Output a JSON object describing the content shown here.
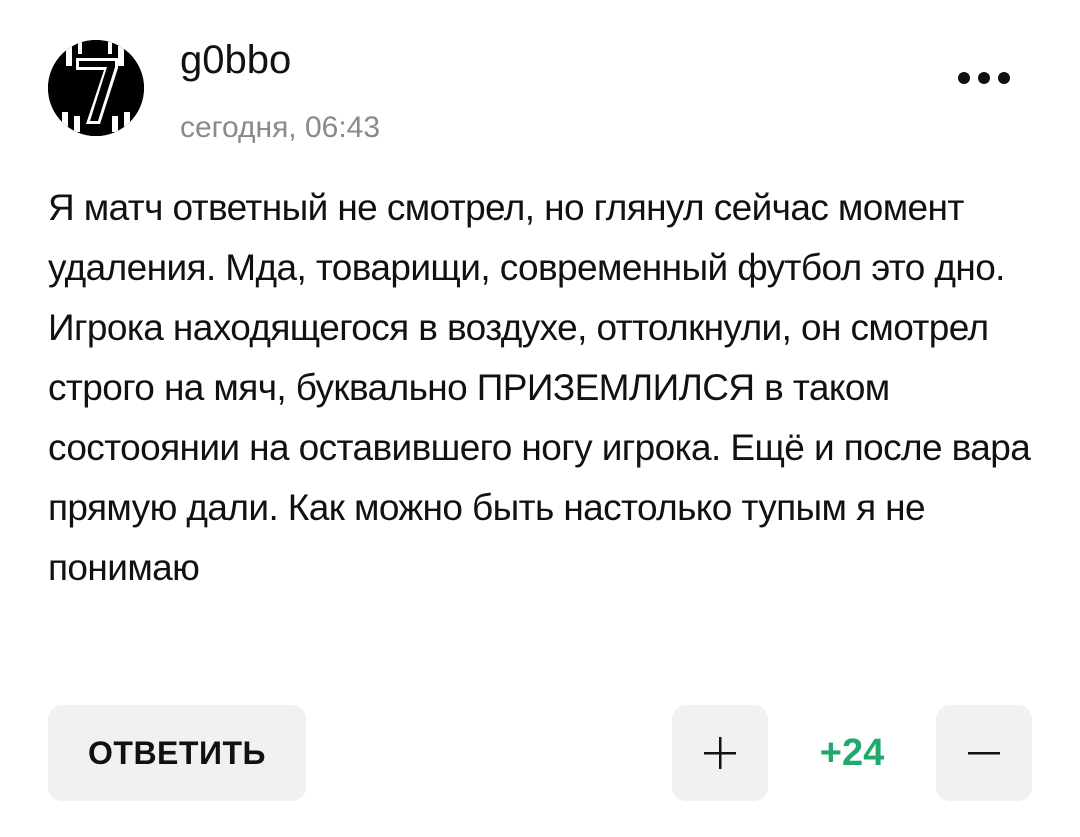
{
  "comment": {
    "author": {
      "username": "g0bbo",
      "avatar_icon": "number-7-jersey-avatar"
    },
    "timestamp": "сегодня, 06:43",
    "more_icon": "more-dots-icon",
    "text": "Я матч ответный не смотрел, но глянул сейчас момент удаления. Мда, товарищи, современный футбол это дно. Игрока находящегося в воздухе, оттолкнули, он смотрел строго на мяч, буквально ПРИЗЕМЛИЛСЯ в таком состооянии на оставившего ногу игрока. Ещё и после вара прямую дали. Как можно быть настолько тупым я не понимаю",
    "actions": {
      "reply_label": "ОТВЕТИТЬ",
      "upvote_icon": "plus-icon",
      "downvote_icon": "minus-icon"
    },
    "rating": {
      "value": "+24",
      "color": "#1faa6b"
    }
  },
  "colors": {
    "button_bg": "#f1f1f1",
    "text": "#111111",
    "muted_text": "#8a8a8a"
  }
}
